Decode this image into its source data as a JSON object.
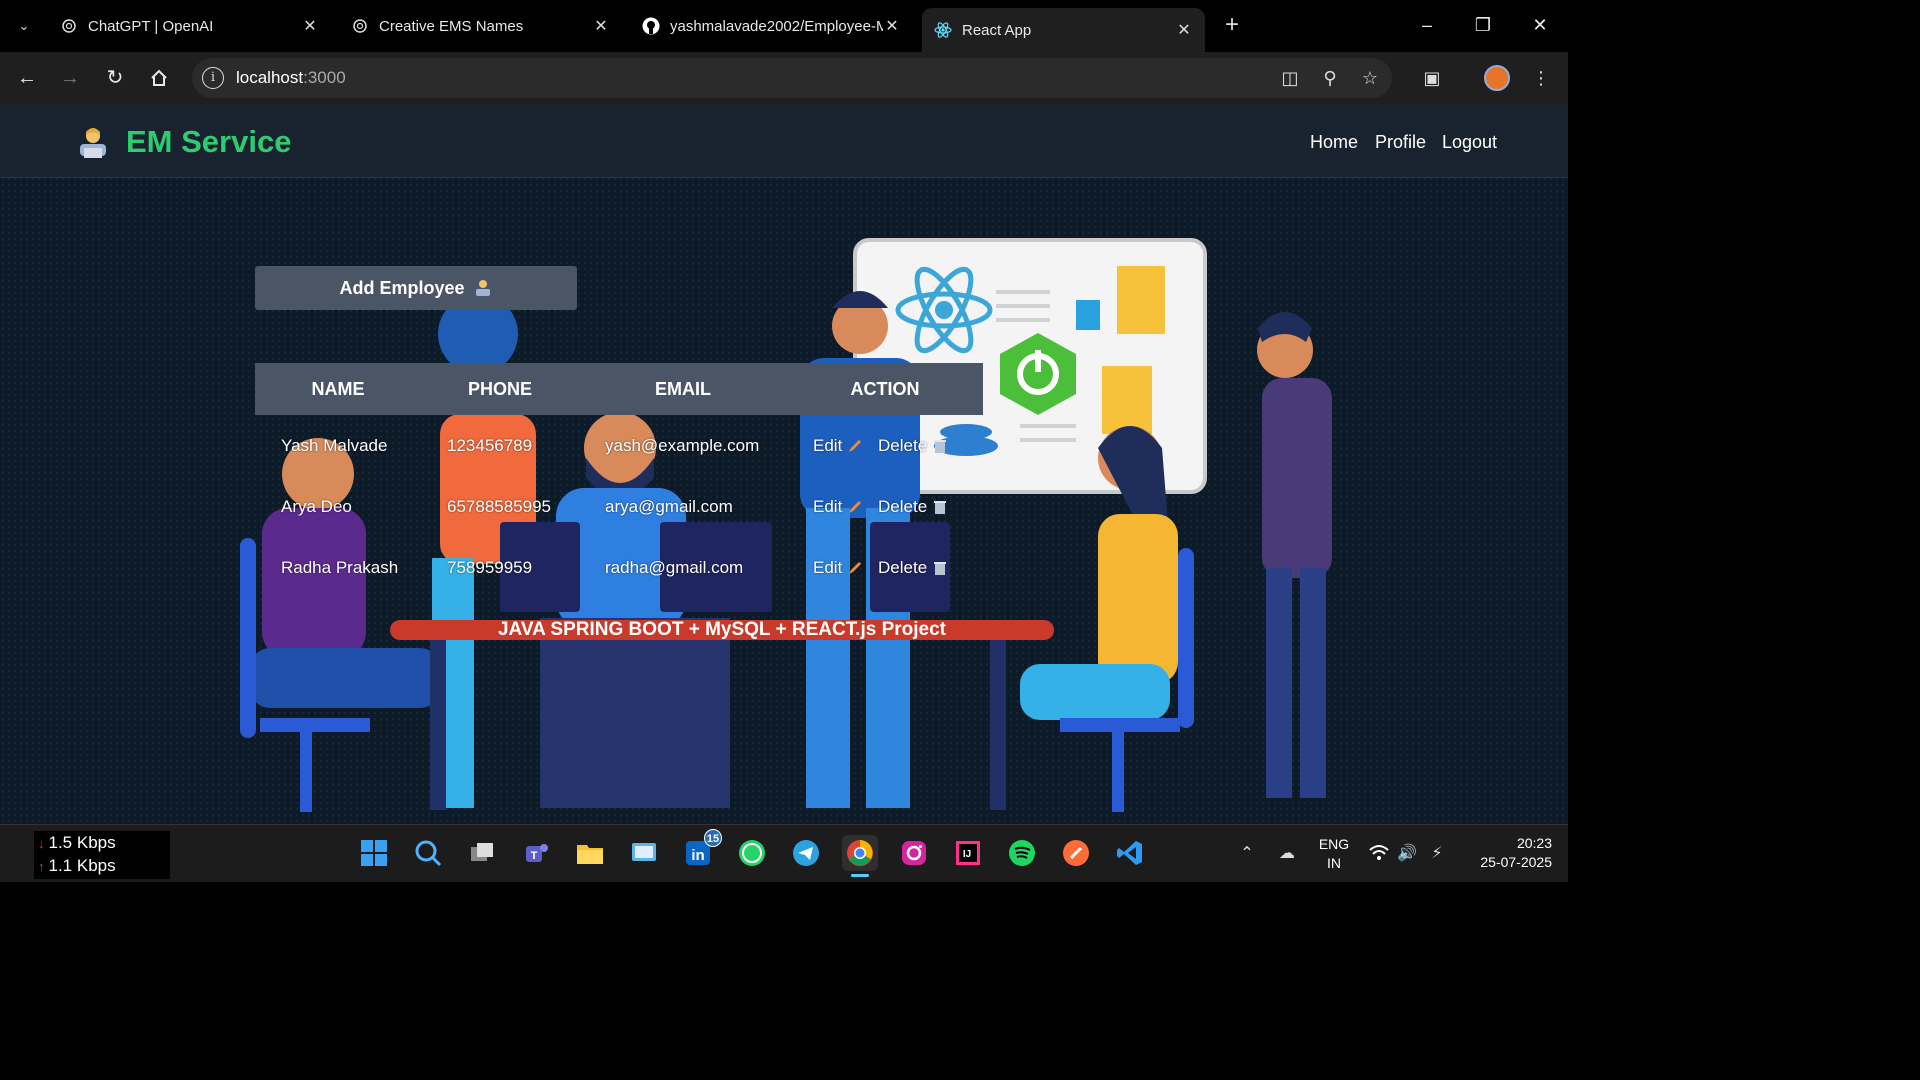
{
  "browser": {
    "tabs": [
      {
        "title": "ChatGPT | OpenAI",
        "icon": "openai-icon",
        "active": false
      },
      {
        "title": "Creative EMS Names",
        "icon": "openai-icon",
        "active": false
      },
      {
        "title": "yashmalavade2002/Employee-M",
        "icon": "github-icon",
        "active": false
      },
      {
        "title": "React App",
        "icon": "react-icon",
        "active": true
      }
    ],
    "url_host": "localhost",
    "url_port": ":3000"
  },
  "app": {
    "brand": "EM Service",
    "nav": [
      "Home",
      "Profile",
      "Logout"
    ],
    "add_button_label": "Add Employee",
    "banner_text": "JAVA SPRING BOOT + MySQL + REACT.js Project",
    "table": {
      "headers": [
        "NAME",
        "PHONE",
        "EMAIL",
        "ACTION"
      ],
      "rows": [
        {
          "name": "Yash Malvade",
          "phone": "123456789",
          "email": "yash@example.com",
          "edit": "Edit",
          "delete": "Delete"
        },
        {
          "name": "Arya Deo",
          "phone": "65788585995",
          "email": "arya@gmail.com",
          "edit": "Edit",
          "delete": "Delete"
        },
        {
          "name": "Radha Prakash",
          "phone": "758959959",
          "email": "radha@gmail.com",
          "edit": "Edit",
          "delete": "Delete"
        }
      ]
    },
    "colors": {
      "brand_green": "#2ecc71",
      "header_bg": "#18232f",
      "table_head_bg": "#4a5665",
      "page_bg": "#0d1b29"
    }
  },
  "taskbar": {
    "net_down": "1.5 Kbps",
    "net_up": "1.1 Kbps",
    "linkedin_badge": "15",
    "lang_primary": "ENG",
    "lang_region": "IN",
    "time": "20:23",
    "date": "25-07-2025"
  }
}
